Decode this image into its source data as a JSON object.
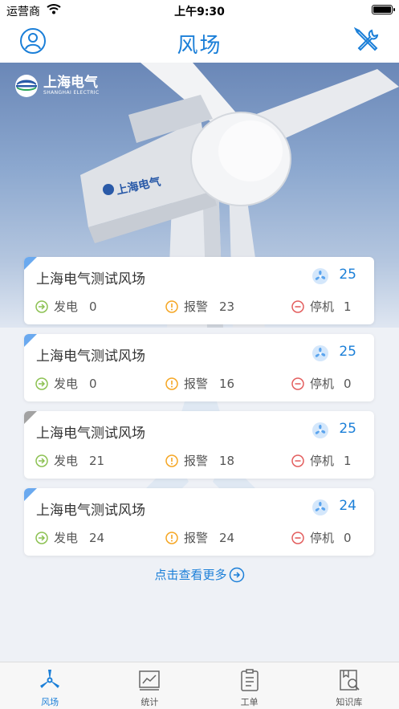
{
  "status_bar": {
    "carrier": "运营商",
    "time": "上午9:30"
  },
  "nav": {
    "title": "风场"
  },
  "hero": {
    "logo_cn": "上海电气",
    "logo_en": "SHANGHAI ELECTRIC"
  },
  "cards": [
    {
      "name": "上海电气测试风场",
      "fan_count": "25",
      "power_label": "发电",
      "power_value": "0",
      "alarm_label": "报警",
      "alarm_value": "23",
      "stop_label": "停机",
      "stop_value": "1",
      "corner_color": "#6aa9ef"
    },
    {
      "name": "上海电气测试风场",
      "fan_count": "25",
      "power_label": "发电",
      "power_value": "0",
      "alarm_label": "报警",
      "alarm_value": "16",
      "stop_label": "停机",
      "stop_value": "0",
      "corner_color": "#6aa9ef"
    },
    {
      "name": "上海电气测试风场",
      "fan_count": "25",
      "power_label": "发电",
      "power_value": "21",
      "alarm_label": "报警",
      "alarm_value": "18",
      "stop_label": "停机",
      "stop_value": "1",
      "corner_color": "#a2a2a2"
    },
    {
      "name": "上海电气测试风场",
      "fan_count": "24",
      "power_label": "发电",
      "power_value": "24",
      "alarm_label": "报警",
      "alarm_value": "24",
      "stop_label": "停机",
      "stop_value": "0",
      "corner_color": "#6aa9ef"
    }
  ],
  "more_link": {
    "label": "点击查看更多"
  },
  "tabs": [
    {
      "label": "风场",
      "icon": "wind-turbine-icon",
      "active": true
    },
    {
      "label": "统计",
      "icon": "statistics-chart-icon",
      "active": false
    },
    {
      "label": "工单",
      "icon": "work-order-clipboard-icon",
      "active": false
    },
    {
      "label": "知识库",
      "icon": "knowledge-search-icon",
      "active": false
    }
  ],
  "colors": {
    "accent": "#1b7fd8",
    "power": "#8cc152",
    "alarm": "#f5a623",
    "stop": "#e35d5d",
    "fan": "#5aa4ee"
  }
}
